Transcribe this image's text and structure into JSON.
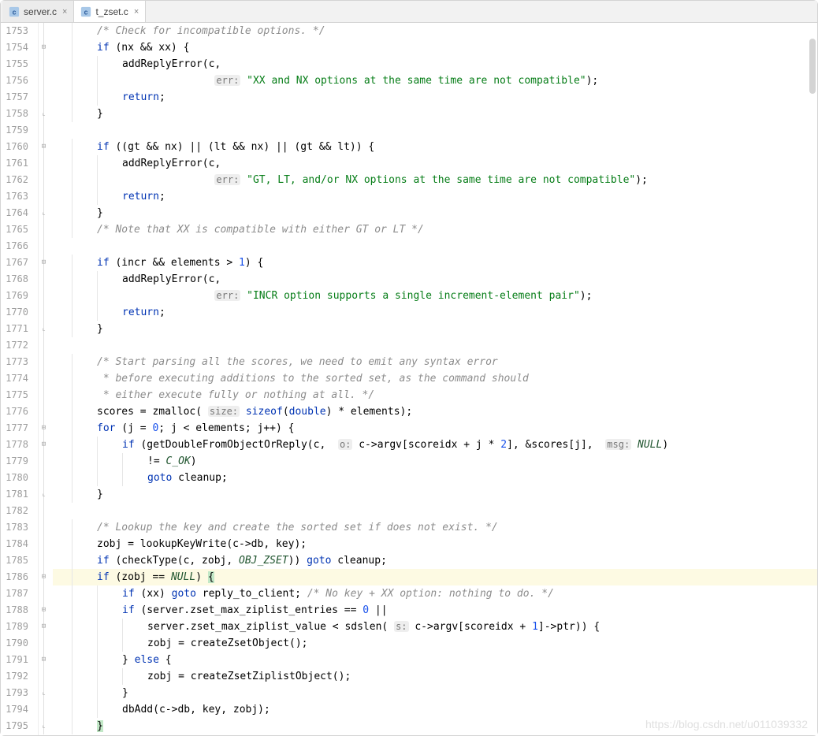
{
  "tabs": [
    {
      "label": "server.c",
      "active": false
    },
    {
      "label": "t_zset.c",
      "active": true
    }
  ],
  "gutter_start": 1753,
  "gutter_end": 1795,
  "highlight_line": 1786,
  "close_glyph": "×",
  "watermark": "https://blog.csdn.net/u011039332",
  "code": {
    "l1753": {
      "indent": 1,
      "class": "com",
      "text": "/* Check for incompatible options. */"
    },
    "l1754": {
      "indent": 1,
      "tokens": [
        [
          "kw",
          "if"
        ],
        [
          "",
          " (nx && xx) {"
        ]
      ]
    },
    "l1755": {
      "indent": 2,
      "tokens": [
        [
          "",
          "addReplyError(c,"
        ]
      ]
    },
    "l1756": {
      "indent": 2,
      "leading": "               ",
      "tokens": [
        [
          "param-hint",
          "err:"
        ],
        [
          "",
          " "
        ],
        [
          "str",
          "\"XX and NX options at the same time are not compatible\""
        ],
        [
          "",
          ");"
        ]
      ]
    },
    "l1757": {
      "indent": 2,
      "tokens": [
        [
          "kw",
          "return"
        ],
        [
          "",
          ";"
        ]
      ]
    },
    "l1758": {
      "indent": 1,
      "tokens": [
        [
          "",
          "}"
        ]
      ]
    },
    "l1759": {
      "indent": 0,
      "tokens": []
    },
    "l1760": {
      "indent": 1,
      "tokens": [
        [
          "kw",
          "if"
        ],
        [
          "",
          " ((gt && nx) || (lt && nx) || (gt && lt)) {"
        ]
      ]
    },
    "l1761": {
      "indent": 2,
      "tokens": [
        [
          "",
          "addReplyError(c,"
        ]
      ]
    },
    "l1762": {
      "indent": 2,
      "leading": "               ",
      "tokens": [
        [
          "param-hint",
          "err:"
        ],
        [
          "",
          " "
        ],
        [
          "str",
          "\"GT, LT, and/or NX options at the same time are not compatible\""
        ],
        [
          "",
          ");"
        ]
      ]
    },
    "l1763": {
      "indent": 2,
      "tokens": [
        [
          "kw",
          "return"
        ],
        [
          "",
          ";"
        ]
      ]
    },
    "l1764": {
      "indent": 1,
      "tokens": [
        [
          "",
          "}"
        ]
      ]
    },
    "l1765": {
      "indent": 1,
      "class": "com",
      "text": "/* Note that XX is compatible with either GT or LT */"
    },
    "l1766": {
      "indent": 0,
      "tokens": []
    },
    "l1767": {
      "indent": 1,
      "tokens": [
        [
          "kw",
          "if"
        ],
        [
          "",
          " (incr && elements > "
        ],
        [
          "num",
          "1"
        ],
        [
          "",
          ") {"
        ]
      ]
    },
    "l1768": {
      "indent": 2,
      "tokens": [
        [
          "",
          "addReplyError(c,"
        ]
      ]
    },
    "l1769": {
      "indent": 2,
      "leading": "               ",
      "tokens": [
        [
          "param-hint",
          "err:"
        ],
        [
          "",
          " "
        ],
        [
          "str",
          "\"INCR option supports a single increment-element pair\""
        ],
        [
          "",
          ");"
        ]
      ]
    },
    "l1770": {
      "indent": 2,
      "tokens": [
        [
          "kw",
          "return"
        ],
        [
          "",
          ";"
        ]
      ]
    },
    "l1771": {
      "indent": 1,
      "tokens": [
        [
          "",
          "}"
        ]
      ]
    },
    "l1772": {
      "indent": 0,
      "tokens": []
    },
    "l1773": {
      "indent": 1,
      "class": "com",
      "text": "/* Start parsing all the scores, we need to emit any syntax error"
    },
    "l1774": {
      "indent": 1,
      "class": "com",
      "text": " * before executing additions to the sorted set, as the command should"
    },
    "l1775": {
      "indent": 1,
      "class": "com",
      "text": " * either execute fully or nothing at all. */"
    },
    "l1776": {
      "indent": 1,
      "tokens": [
        [
          "",
          "scores = zmalloc( "
        ],
        [
          "param-hint",
          "size:"
        ],
        [
          "",
          " "
        ],
        [
          "kw",
          "sizeof"
        ],
        [
          "",
          "("
        ],
        [
          "kw",
          "double"
        ],
        [
          "",
          ") * elements);"
        ]
      ]
    },
    "l1777": {
      "indent": 1,
      "tokens": [
        [
          "kw",
          "for"
        ],
        [
          "",
          " (j = "
        ],
        [
          "num",
          "0"
        ],
        [
          "",
          "; j < elements; j++) {"
        ]
      ]
    },
    "l1778": {
      "indent": 2,
      "tokens": [
        [
          "kw",
          "if"
        ],
        [
          "",
          " (getDoubleFromObjectOrReply(c,  "
        ],
        [
          "param-hint",
          "o:"
        ],
        [
          "",
          " c->argv[scoreidx + j * "
        ],
        [
          "num",
          "2"
        ],
        [
          "",
          "], &scores[j],  "
        ],
        [
          "param-hint",
          "msg:"
        ],
        [
          "",
          " "
        ],
        [
          "mac",
          "NULL"
        ],
        [
          "",
          ")"
        ]
      ]
    },
    "l1779": {
      "indent": 3,
      "tokens": [
        [
          "",
          "!= "
        ],
        [
          "mac",
          "C_OK"
        ],
        [
          "",
          ")"
        ]
      ]
    },
    "l1780": {
      "indent": 3,
      "tokens": [
        [
          "kw",
          "goto"
        ],
        [
          "",
          " cleanup;"
        ]
      ]
    },
    "l1781": {
      "indent": 1,
      "tokens": [
        [
          "",
          "}"
        ]
      ]
    },
    "l1782": {
      "indent": 0,
      "tokens": []
    },
    "l1783": {
      "indent": 1,
      "class": "com",
      "text": "/* Lookup the key and create the sorted set if does not exist. */"
    },
    "l1784": {
      "indent": 1,
      "tokens": [
        [
          "",
          "zobj = lookupKeyWrite(c->db, key);"
        ]
      ]
    },
    "l1785": {
      "indent": 1,
      "tokens": [
        [
          "kw",
          "if"
        ],
        [
          "",
          " (checkType(c, zobj, "
        ],
        [
          "mac",
          "OBJ_ZSET"
        ],
        [
          "",
          ")) "
        ],
        [
          "kw",
          "goto"
        ],
        [
          "",
          " cleanup;"
        ]
      ]
    },
    "l1786": {
      "indent": 1,
      "tokens": [
        [
          "kw",
          "if"
        ],
        [
          "",
          " (zobj == "
        ],
        [
          "mac",
          "NULL"
        ],
        [
          "",
          ") "
        ],
        [
          "caret-bg",
          "{"
        ]
      ]
    },
    "l1787": {
      "indent": 2,
      "tokens": [
        [
          "kw",
          "if"
        ],
        [
          "",
          " (xx) "
        ],
        [
          "kw",
          "goto"
        ],
        [
          "",
          " reply_to_client; "
        ],
        [
          "com",
          "/* No key + XX option: nothing to do. */"
        ]
      ]
    },
    "l1788": {
      "indent": 2,
      "tokens": [
        [
          "kw",
          "if"
        ],
        [
          "",
          " (server.zset_max_ziplist_entries == "
        ],
        [
          "num",
          "0"
        ],
        [
          "",
          " ||"
        ]
      ]
    },
    "l1789": {
      "indent": 3,
      "tokens": [
        [
          "",
          "server.zset_max_ziplist_value < sdslen( "
        ],
        [
          "param-hint",
          "s:"
        ],
        [
          "",
          " c->argv[scoreidx + "
        ],
        [
          "num",
          "1"
        ],
        [
          "",
          "]->ptr)) {"
        ]
      ]
    },
    "l1790": {
      "indent": 3,
      "tokens": [
        [
          "",
          "zobj = createZsetObject();"
        ]
      ]
    },
    "l1791": {
      "indent": 2,
      "tokens": [
        [
          "",
          "} "
        ],
        [
          "kw",
          "else"
        ],
        [
          "",
          " {"
        ]
      ]
    },
    "l1792": {
      "indent": 3,
      "tokens": [
        [
          "",
          "zobj = createZsetZiplistObject();"
        ]
      ]
    },
    "l1793": {
      "indent": 2,
      "tokens": [
        [
          "",
          "}"
        ]
      ]
    },
    "l1794": {
      "indent": 2,
      "tokens": [
        [
          "",
          "dbAdd(c->db, key, zobj);"
        ]
      ]
    },
    "l1795": {
      "indent": 1,
      "tokens": [
        [
          "caret-bg",
          "}"
        ]
      ]
    }
  }
}
